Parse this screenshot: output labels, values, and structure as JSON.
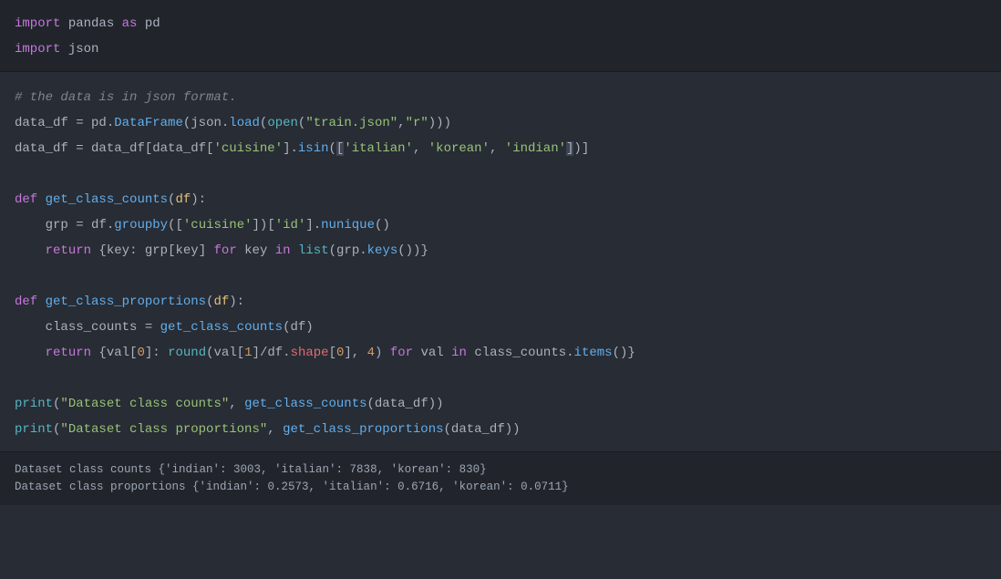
{
  "cell1": {
    "line1": {
      "import": "import",
      "pandas": "pandas",
      "as": "as",
      "pd": "pd"
    },
    "line2": {
      "import": "import",
      "json": "json"
    }
  },
  "cell2": {
    "comment": "# the data is in json format.",
    "line2": {
      "data_df": "data_df",
      "eq": " = ",
      "pd": "pd",
      "dot": ".",
      "DataFrame": "DataFrame",
      "p1": "(",
      "json": "json",
      "dot2": ".",
      "load": "load",
      "p2": "(",
      "open": "open",
      "p3": "(",
      "s1": "\"train.json\"",
      "c1": ",",
      "s2": "\"r\"",
      "p4": ")))"
    },
    "line3": {
      "data_df": "data_df",
      "eq": " = ",
      "data_df2": "data_df",
      "b1": "[",
      "data_df3": "data_df",
      "b2": "[",
      "s1": "'cuisine'",
      "b3": "].",
      "isin": "isin",
      "p1": "(",
      "bhl1": "[",
      "s2": "'italian'",
      "c1": ", ",
      "s3": "'korean'",
      "c2": ", ",
      "s4": "'indian'",
      "bhl2": "]",
      "p2": ")]"
    },
    "line5": {
      "def": "def",
      "sp": " ",
      "name": "get_class_counts",
      "p1": "(",
      "df": "df",
      "p2": "):"
    },
    "line6": {
      "indent": "    ",
      "grp": "grp",
      "eq": " = ",
      "df": "df",
      "dot": ".",
      "groupby": "groupby",
      "p1": "([",
      "s1": "'cuisine'",
      "p2": "])[",
      "s2": "'id'",
      "p3": "].",
      "nunique": "nunique",
      "p4": "()"
    },
    "line7": {
      "indent": "    ",
      "return": "return",
      "sp": " {",
      "key": "key",
      "c1": ": ",
      "grp": "grp",
      "b1": "[",
      "key2": "key",
      "b2": "] ",
      "for": "for",
      "sp2": " ",
      "key3": "key",
      "sp3": " ",
      "in": "in",
      "sp4": " ",
      "list": "list",
      "p1": "(",
      "grp2": "grp",
      "dot": ".",
      "keys": "keys",
      "p2": "())}"
    },
    "line9": {
      "def": "def",
      "sp": " ",
      "name": "get_class_proportions",
      "p1": "(",
      "df": "df",
      "p2": "):"
    },
    "line10": {
      "indent": "    ",
      "cc": "class_counts",
      "eq": " = ",
      "gcc": "get_class_counts",
      "p1": "(",
      "df": "df",
      "p2": ")"
    },
    "line11": {
      "indent": "    ",
      "return": "return",
      "sp": " {",
      "val": "val",
      "b1": "[",
      "n0": "0",
      "b2": "]: ",
      "round": "round",
      "p1": "(",
      "val2": "val",
      "b3": "[",
      "n1": "1",
      "b4": "]",
      "div": "/",
      "df": "df",
      "dot": ".",
      "shape": "shape",
      "b5": "[",
      "n0b": "0",
      "b6": "], ",
      "n4": "4",
      "p2": ") ",
      "for": "for",
      "sp2": " ",
      "val3": "val",
      "sp3": " ",
      "in": "in",
      "sp4": " ",
      "cc": "class_counts",
      "dot2": ".",
      "items": "items",
      "p3": "()}"
    },
    "line13": {
      "print": "print",
      "p1": "(",
      "s1": "\"Dataset class counts\"",
      "c1": ", ",
      "gcc": "get_class_counts",
      "p2": "(",
      "dd": "data_df",
      "p3": "))"
    },
    "line14": {
      "print": "print",
      "p1": "(",
      "s1": "\"Dataset class proportions\"",
      "c1": ", ",
      "gcp": "get_class_proportions",
      "p2": "(",
      "dd": "data_df",
      "p3": "))"
    }
  },
  "output": {
    "line1": "Dataset class counts {'indian': 3003, 'italian': 7838, 'korean': 830}",
    "line2": "Dataset class proportions {'indian': 0.2573, 'italian': 0.6716, 'korean': 0.0711}"
  }
}
